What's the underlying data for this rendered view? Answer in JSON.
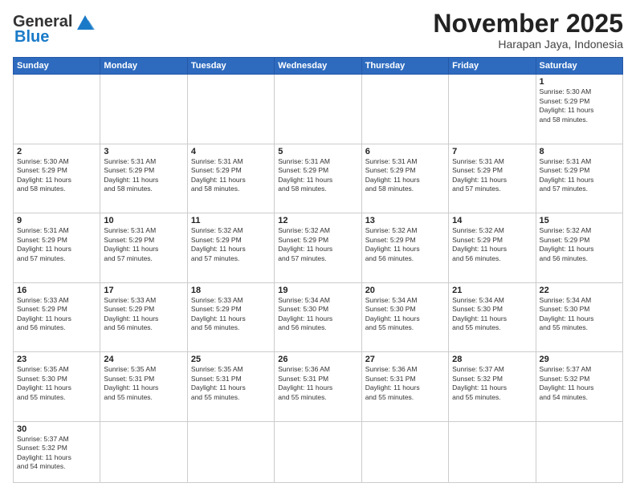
{
  "header": {
    "logo_general": "General",
    "logo_blue": "Blue",
    "month_year": "November 2025",
    "location": "Harapan Jaya, Indonesia"
  },
  "days_of_week": [
    "Sunday",
    "Monday",
    "Tuesday",
    "Wednesday",
    "Thursday",
    "Friday",
    "Saturday"
  ],
  "weeks": [
    [
      {
        "day": "",
        "info": ""
      },
      {
        "day": "",
        "info": ""
      },
      {
        "day": "",
        "info": ""
      },
      {
        "day": "",
        "info": ""
      },
      {
        "day": "",
        "info": ""
      },
      {
        "day": "",
        "info": ""
      },
      {
        "day": "1",
        "info": "Sunrise: 5:30 AM\nSunset: 5:29 PM\nDaylight: 11 hours\nand 58 minutes."
      }
    ],
    [
      {
        "day": "2",
        "info": "Sunrise: 5:30 AM\nSunset: 5:29 PM\nDaylight: 11 hours\nand 58 minutes."
      },
      {
        "day": "3",
        "info": "Sunrise: 5:31 AM\nSunset: 5:29 PM\nDaylight: 11 hours\nand 58 minutes."
      },
      {
        "day": "4",
        "info": "Sunrise: 5:31 AM\nSunset: 5:29 PM\nDaylight: 11 hours\nand 58 minutes."
      },
      {
        "day": "5",
        "info": "Sunrise: 5:31 AM\nSunset: 5:29 PM\nDaylight: 11 hours\nand 58 minutes."
      },
      {
        "day": "6",
        "info": "Sunrise: 5:31 AM\nSunset: 5:29 PM\nDaylight: 11 hours\nand 58 minutes."
      },
      {
        "day": "7",
        "info": "Sunrise: 5:31 AM\nSunset: 5:29 PM\nDaylight: 11 hours\nand 57 minutes."
      },
      {
        "day": "8",
        "info": "Sunrise: 5:31 AM\nSunset: 5:29 PM\nDaylight: 11 hours\nand 57 minutes."
      }
    ],
    [
      {
        "day": "9",
        "info": "Sunrise: 5:31 AM\nSunset: 5:29 PM\nDaylight: 11 hours\nand 57 minutes."
      },
      {
        "day": "10",
        "info": "Sunrise: 5:31 AM\nSunset: 5:29 PM\nDaylight: 11 hours\nand 57 minutes."
      },
      {
        "day": "11",
        "info": "Sunrise: 5:32 AM\nSunset: 5:29 PM\nDaylight: 11 hours\nand 57 minutes."
      },
      {
        "day": "12",
        "info": "Sunrise: 5:32 AM\nSunset: 5:29 PM\nDaylight: 11 hours\nand 57 minutes."
      },
      {
        "day": "13",
        "info": "Sunrise: 5:32 AM\nSunset: 5:29 PM\nDaylight: 11 hours\nand 56 minutes."
      },
      {
        "day": "14",
        "info": "Sunrise: 5:32 AM\nSunset: 5:29 PM\nDaylight: 11 hours\nand 56 minutes."
      },
      {
        "day": "15",
        "info": "Sunrise: 5:32 AM\nSunset: 5:29 PM\nDaylight: 11 hours\nand 56 minutes."
      }
    ],
    [
      {
        "day": "16",
        "info": "Sunrise: 5:33 AM\nSunset: 5:29 PM\nDaylight: 11 hours\nand 56 minutes."
      },
      {
        "day": "17",
        "info": "Sunrise: 5:33 AM\nSunset: 5:29 PM\nDaylight: 11 hours\nand 56 minutes."
      },
      {
        "day": "18",
        "info": "Sunrise: 5:33 AM\nSunset: 5:29 PM\nDaylight: 11 hours\nand 56 minutes."
      },
      {
        "day": "19",
        "info": "Sunrise: 5:34 AM\nSunset: 5:30 PM\nDaylight: 11 hours\nand 56 minutes."
      },
      {
        "day": "20",
        "info": "Sunrise: 5:34 AM\nSunset: 5:30 PM\nDaylight: 11 hours\nand 55 minutes."
      },
      {
        "day": "21",
        "info": "Sunrise: 5:34 AM\nSunset: 5:30 PM\nDaylight: 11 hours\nand 55 minutes."
      },
      {
        "day": "22",
        "info": "Sunrise: 5:34 AM\nSunset: 5:30 PM\nDaylight: 11 hours\nand 55 minutes."
      }
    ],
    [
      {
        "day": "23",
        "info": "Sunrise: 5:35 AM\nSunset: 5:30 PM\nDaylight: 11 hours\nand 55 minutes."
      },
      {
        "day": "24",
        "info": "Sunrise: 5:35 AM\nSunset: 5:31 PM\nDaylight: 11 hours\nand 55 minutes."
      },
      {
        "day": "25",
        "info": "Sunrise: 5:35 AM\nSunset: 5:31 PM\nDaylight: 11 hours\nand 55 minutes."
      },
      {
        "day": "26",
        "info": "Sunrise: 5:36 AM\nSunset: 5:31 PM\nDaylight: 11 hours\nand 55 minutes."
      },
      {
        "day": "27",
        "info": "Sunrise: 5:36 AM\nSunset: 5:31 PM\nDaylight: 11 hours\nand 55 minutes."
      },
      {
        "day": "28",
        "info": "Sunrise: 5:37 AM\nSunset: 5:32 PM\nDaylight: 11 hours\nand 55 minutes."
      },
      {
        "day": "29",
        "info": "Sunrise: 5:37 AM\nSunset: 5:32 PM\nDaylight: 11 hours\nand 54 minutes."
      }
    ],
    [
      {
        "day": "30",
        "info": "Sunrise: 5:37 AM\nSunset: 5:32 PM\nDaylight: 11 hours\nand 54 minutes."
      },
      {
        "day": "",
        "info": ""
      },
      {
        "day": "",
        "info": ""
      },
      {
        "day": "",
        "info": ""
      },
      {
        "day": "",
        "info": ""
      },
      {
        "day": "",
        "info": ""
      },
      {
        "day": "",
        "info": ""
      }
    ]
  ]
}
